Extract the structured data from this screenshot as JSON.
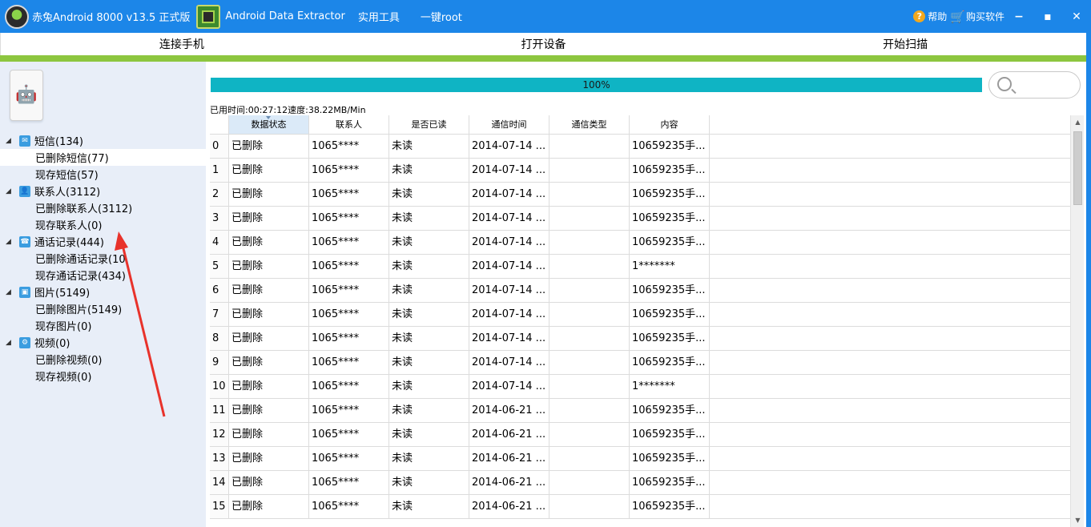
{
  "titlebar": {
    "app_title": "赤兔Android 8000 v13.5 正式版",
    "extractor_title": "Android Data Extractor",
    "tools": "实用工具",
    "root": "一键root",
    "help": "帮助",
    "buy": "购买软件",
    "help_glyph": "?",
    "cart_glyph": "🛒",
    "min_glyph": "−",
    "max_glyph": "▪",
    "close_glyph": "✕",
    "accent_color": "#1c86e8"
  },
  "steps": [
    "连接手机",
    "打开设备",
    "开始扫描"
  ],
  "sidebar": {
    "tree": [
      {
        "label": "短信(134)",
        "icon": "mail-icon",
        "children": [
          "已删除短信(77)",
          "现存短信(57)"
        ]
      },
      {
        "label": "联系人(3112)",
        "icon": "contact-icon",
        "children": [
          "已删除联系人(3112)",
          "现存联系人(0)"
        ]
      },
      {
        "label": "通话记录(444)",
        "icon": "phone-icon",
        "children": [
          "已删除通话记录(10",
          "现存通话记录(434)"
        ]
      },
      {
        "label": "图片(5149)",
        "icon": "image-icon",
        "children": [
          "已删除图片(5149)",
          "现存图片(0)"
        ]
      },
      {
        "label": "视频(0)",
        "icon": "video-icon",
        "children": [
          "已删除视频(0)",
          "现存视频(0)"
        ]
      }
    ]
  },
  "progress": {
    "text": "100%",
    "value": 1.0
  },
  "speed_text": "已用时间:00:27:12速度:38.22MB/Min",
  "table": {
    "columns": [
      "数据状态",
      "联系人",
      "是否已读",
      "通信时间",
      "通信类型",
      "内容"
    ],
    "rows": [
      [
        "0",
        "已删除",
        "1065****",
        "未读",
        "2014-07-14 ...",
        "",
        "10659235手..."
      ],
      [
        "1",
        "已删除",
        "1065****",
        "未读",
        "2014-07-14 ...",
        "",
        "10659235手..."
      ],
      [
        "2",
        "已删除",
        "1065****",
        "未读",
        "2014-07-14 ...",
        "",
        "10659235手..."
      ],
      [
        "3",
        "已删除",
        "1065****",
        "未读",
        "2014-07-14 ...",
        "",
        "10659235手..."
      ],
      [
        "4",
        "已删除",
        "1065****",
        "未读",
        "2014-07-14 ...",
        "",
        "10659235手..."
      ],
      [
        "5",
        "已删除",
        "1065****",
        "未读",
        "2014-07-14 ...",
        "",
        "1*******"
      ],
      [
        "6",
        "已删除",
        "1065****",
        "未读",
        "2014-07-14 ...",
        "",
        "10659235手..."
      ],
      [
        "7",
        "已删除",
        "1065****",
        "未读",
        "2014-07-14 ...",
        "",
        "10659235手..."
      ],
      [
        "8",
        "已删除",
        "1065****",
        "未读",
        "2014-07-14 ...",
        "",
        "10659235手..."
      ],
      [
        "9",
        "已删除",
        "1065****",
        "未读",
        "2014-07-14 ...",
        "",
        "10659235手..."
      ],
      [
        "10",
        "已删除",
        "1065****",
        "未读",
        "2014-07-14 ...",
        "",
        "1*******"
      ],
      [
        "11",
        "已删除",
        "1065****",
        "未读",
        "2014-06-21 ...",
        "",
        "10659235手..."
      ],
      [
        "12",
        "已删除",
        "1065****",
        "未读",
        "2014-06-21 ...",
        "",
        "10659235手..."
      ],
      [
        "13",
        "已删除",
        "1065****",
        "未读",
        "2014-06-21 ...",
        "",
        "10659235手..."
      ],
      [
        "14",
        "已删除",
        "1065****",
        "未读",
        "2014-06-21 ...",
        "",
        "10659235手..."
      ],
      [
        "15",
        "已删除",
        "1065****",
        "未读",
        "2014-06-21 ...",
        "",
        "10659235手..."
      ]
    ]
  }
}
